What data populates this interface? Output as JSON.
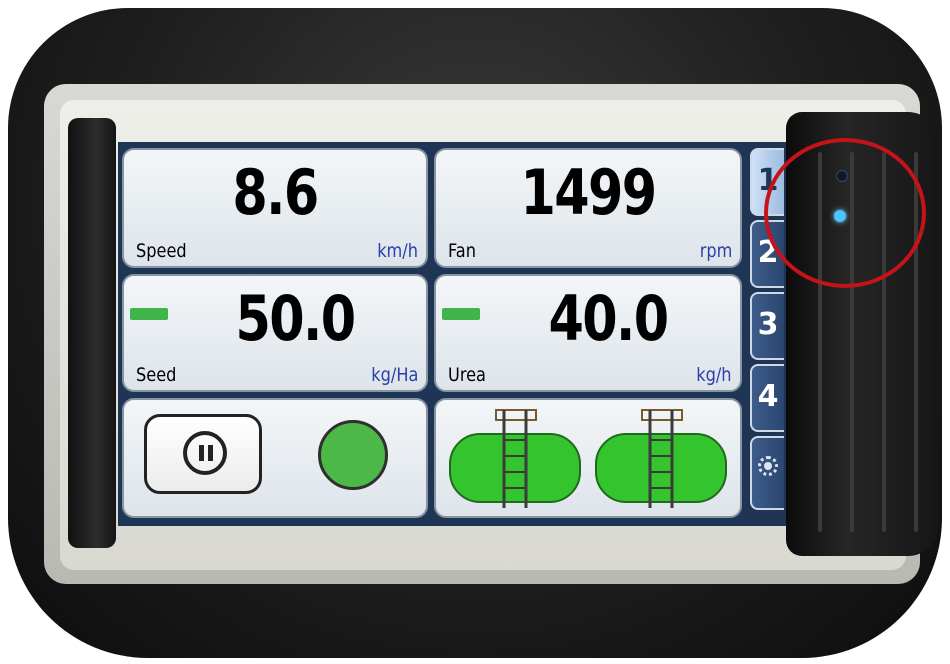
{
  "tiles": {
    "speed": {
      "value": "8.6",
      "label": "Speed",
      "unit": "km/h"
    },
    "fan": {
      "value": "1499",
      "label": "Fan",
      "unit": "rpm"
    },
    "seed": {
      "value": "50.0",
      "label": "Seed",
      "unit": "kg/Ha"
    },
    "urea": {
      "value": "40.0",
      "label": "Urea",
      "unit": "kg/h"
    }
  },
  "tabs": [
    {
      "label": "1",
      "active": true
    },
    {
      "label": "2"
    },
    {
      "label": "3"
    },
    {
      "label": "4"
    },
    {
      "icon": "settings-gear-icon"
    }
  ],
  "colors": {
    "screen_bg": "#1f3556",
    "unit_text": "#2b3fa8",
    "status_green": "#4cb848",
    "tank_green": "#34c42e",
    "highlight_ring": "#c4141a",
    "led_blue": "#4cc6ff"
  },
  "controls": {
    "pause_icon": "pause-icon",
    "status_indicator": "green-status-dot"
  },
  "tanks": {
    "count": 2,
    "icon": "tank-icon"
  }
}
